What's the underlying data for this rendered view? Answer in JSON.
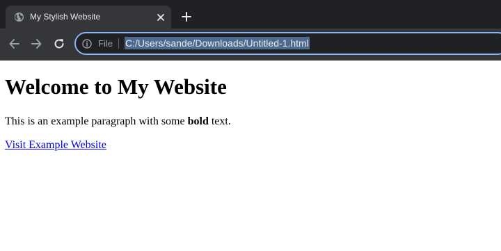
{
  "browser": {
    "tab": {
      "title": "My Stylish Website",
      "favicon_icon": "globe-icon",
      "close_icon": "close-icon"
    },
    "new_tab_icon": "plus-icon",
    "toolbar": {
      "back_icon": "arrow-left-icon",
      "forward_icon": "arrow-right-icon",
      "reload_icon": "reload-icon"
    },
    "omnibox": {
      "info_icon": "info-icon",
      "scheme_chip": "File",
      "url": "C:/Users/sande/Downloads/Untitled-1.html"
    },
    "colors": {
      "tabstrip_bg": "#202124",
      "toolbar_bg": "#35363a",
      "omnibox_focus_border": "#8ab4f8",
      "url_selection_bg": "#4d6a8f",
      "link": "#0000ee"
    }
  },
  "page": {
    "heading": "Welcome to My Website",
    "paragraph": {
      "before": "This is an example paragraph with some ",
      "bold": "bold",
      "after": " text."
    },
    "link_text": "Visit Example Website"
  }
}
